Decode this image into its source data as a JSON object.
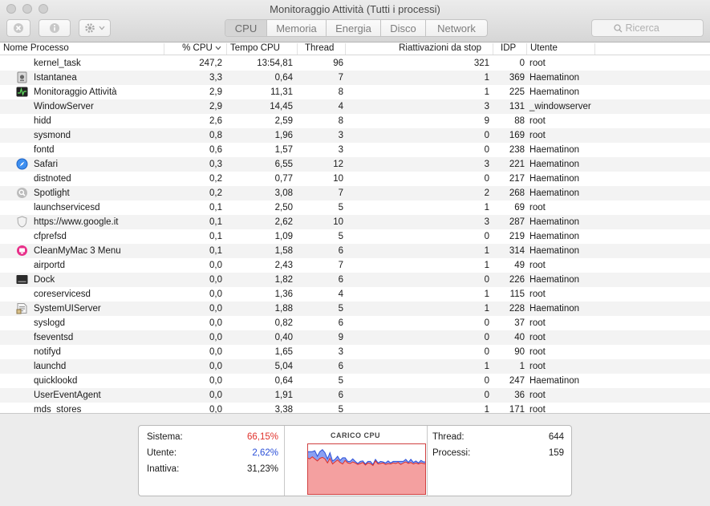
{
  "window": {
    "title": "Monitoraggio Attività (Tutti i processi)"
  },
  "toolbar": {
    "tabs": [
      "CPU",
      "Memoria",
      "Energia",
      "Disco",
      "Network"
    ],
    "active_tab": "CPU",
    "search_placeholder": "Ricerca"
  },
  "table": {
    "columns": [
      "Nome Processo",
      "% CPU",
      "Tempo CPU",
      "Thread",
      "Riattivazioni da stop",
      "IDP",
      "Utente"
    ],
    "rows": [
      {
        "name": "kernel_task",
        "cpu": "247,2",
        "time": "13:54,81",
        "threads": "96",
        "wakeups": "321",
        "pid": "0",
        "user": "root",
        "icon": ""
      },
      {
        "name": "Istantanea",
        "cpu": "3,3",
        "time": "0,64",
        "threads": "7",
        "wakeups": "1",
        "pid": "369",
        "user": "Haematinon",
        "icon": "grab-icon"
      },
      {
        "name": "Monitoraggio Attività",
        "cpu": "2,9",
        "time": "11,31",
        "threads": "8",
        "wakeups": "1",
        "pid": "225",
        "user": "Haematinon",
        "icon": "activity-monitor-icon"
      },
      {
        "name": "WindowServer",
        "cpu": "2,9",
        "time": "14,45",
        "threads": "4",
        "wakeups": "3",
        "pid": "131",
        "user": "_windowserver",
        "icon": ""
      },
      {
        "name": "hidd",
        "cpu": "2,6",
        "time": "2,59",
        "threads": "8",
        "wakeups": "9",
        "pid": "88",
        "user": "root",
        "icon": ""
      },
      {
        "name": "sysmond",
        "cpu": "0,8",
        "time": "1,96",
        "threads": "3",
        "wakeups": "0",
        "pid": "169",
        "user": "root",
        "icon": ""
      },
      {
        "name": "fontd",
        "cpu": "0,6",
        "time": "1,57",
        "threads": "3",
        "wakeups": "0",
        "pid": "238",
        "user": "Haematinon",
        "icon": ""
      },
      {
        "name": "Safari",
        "cpu": "0,3",
        "time": "6,55",
        "threads": "12",
        "wakeups": "3",
        "pid": "221",
        "user": "Haematinon",
        "icon": "safari-icon"
      },
      {
        "name": "distnoted",
        "cpu": "0,2",
        "time": "0,77",
        "threads": "10",
        "wakeups": "0",
        "pid": "217",
        "user": "Haematinon",
        "icon": ""
      },
      {
        "name": "Spotlight",
        "cpu": "0,2",
        "time": "3,08",
        "threads": "7",
        "wakeups": "2",
        "pid": "268",
        "user": "Haematinon",
        "icon": "spotlight-icon"
      },
      {
        "name": "launchservicesd",
        "cpu": "0,1",
        "time": "2,50",
        "threads": "5",
        "wakeups": "1",
        "pid": "69",
        "user": "root",
        "icon": ""
      },
      {
        "name": "https://www.google.it",
        "cpu": "0,1",
        "time": "2,62",
        "threads": "10",
        "wakeups": "3",
        "pid": "287",
        "user": "Haematinon",
        "icon": "shield-icon"
      },
      {
        "name": "cfprefsd",
        "cpu": "0,1",
        "time": "1,09",
        "threads": "5",
        "wakeups": "0",
        "pid": "219",
        "user": "Haematinon",
        "icon": ""
      },
      {
        "name": "CleanMyMac 3 Menu",
        "cpu": "0,1",
        "time": "1,58",
        "threads": "6",
        "wakeups": "1",
        "pid": "314",
        "user": "Haematinon",
        "icon": "cleanmymac-icon"
      },
      {
        "name": "airportd",
        "cpu": "0,0",
        "time": "2,43",
        "threads": "7",
        "wakeups": "1",
        "pid": "49",
        "user": "root",
        "icon": ""
      },
      {
        "name": "Dock",
        "cpu": "0,0",
        "time": "1,82",
        "threads": "6",
        "wakeups": "0",
        "pid": "226",
        "user": "Haematinon",
        "icon": "dock-icon"
      },
      {
        "name": "coreservicesd",
        "cpu": "0,0",
        "time": "1,36",
        "threads": "4",
        "wakeups": "1",
        "pid": "115",
        "user": "root",
        "icon": ""
      },
      {
        "name": "SystemUIServer",
        "cpu": "0,0",
        "time": "1,88",
        "threads": "5",
        "wakeups": "1",
        "pid": "228",
        "user": "Haematinon",
        "icon": "systemuiserver-icon"
      },
      {
        "name": "syslogd",
        "cpu": "0,0",
        "time": "0,82",
        "threads": "6",
        "wakeups": "0",
        "pid": "37",
        "user": "root",
        "icon": ""
      },
      {
        "name": "fseventsd",
        "cpu": "0,0",
        "time": "0,40",
        "threads": "9",
        "wakeups": "0",
        "pid": "40",
        "user": "root",
        "icon": ""
      },
      {
        "name": "notifyd",
        "cpu": "0,0",
        "time": "1,65",
        "threads": "3",
        "wakeups": "0",
        "pid": "90",
        "user": "root",
        "icon": ""
      },
      {
        "name": "launchd",
        "cpu": "0,0",
        "time": "5,04",
        "threads": "6",
        "wakeups": "1",
        "pid": "1",
        "user": "root",
        "icon": ""
      },
      {
        "name": "quicklookd",
        "cpu": "0,0",
        "time": "0,64",
        "threads": "5",
        "wakeups": "0",
        "pid": "247",
        "user": "Haematinon",
        "icon": ""
      },
      {
        "name": "UserEventAgent",
        "cpu": "0,0",
        "time": "1,91",
        "threads": "6",
        "wakeups": "0",
        "pid": "36",
        "user": "root",
        "icon": ""
      },
      {
        "name": "mds_stores",
        "cpu": "0,0",
        "time": "3,38",
        "threads": "5",
        "wakeups": "1",
        "pid": "171",
        "user": "root",
        "icon": ""
      }
    ]
  },
  "summary": {
    "system_label": "Sistema:",
    "system_value": "66,15%",
    "system_color": "#e0302a",
    "user_label": "Utente:",
    "user_value": "2,62%",
    "user_color": "#2a4fd8",
    "idle_label": "Inattiva:",
    "idle_value": "31,23%",
    "chart_title": "CARICO CPU",
    "threads_label": "Thread:",
    "threads_value": "644",
    "processes_label": "Processi:",
    "processes_value": "159",
    "system_load_series": [
      0.72,
      0.7,
      0.74,
      0.7,
      0.66,
      0.71,
      0.73,
      0.7,
      0.62,
      0.71,
      0.6,
      0.64,
      0.68,
      0.63,
      0.6,
      0.67,
      0.62,
      0.61,
      0.64,
      0.62,
      0.59,
      0.61,
      0.63,
      0.58,
      0.62,
      0.61,
      0.57,
      0.66,
      0.6,
      0.61,
      0.62,
      0.59,
      0.61,
      0.6,
      0.62,
      0.61,
      0.63,
      0.59,
      0.62,
      0.64,
      0.61,
      0.63,
      0.6,
      0.62,
      0.6,
      0.62,
      0.61,
      0.6
    ],
    "user_load_series": [
      0.12,
      0.14,
      0.1,
      0.16,
      0.09,
      0.13,
      0.15,
      0.12,
      0.08,
      0.11,
      0.06,
      0.05,
      0.07,
      0.04,
      0.12,
      0.05,
      0.03,
      0.04,
      0.06,
      0.03,
      0.02,
      0.04,
      0.03,
      0.02,
      0.03,
      0.04,
      0.02,
      0.03,
      0.02,
      0.04,
      0.02,
      0.03,
      0.05,
      0.02,
      0.03,
      0.04,
      0.02,
      0.06,
      0.03,
      0.05,
      0.02,
      0.06,
      0.03,
      0.04,
      0.02,
      0.05,
      0.03,
      0.04
    ]
  }
}
